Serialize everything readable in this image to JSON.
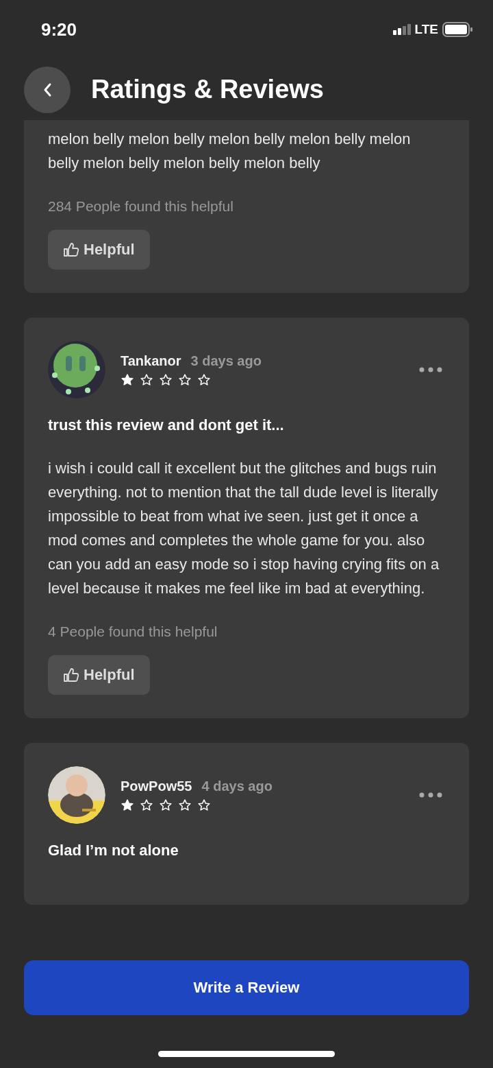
{
  "status_bar": {
    "time": "9:20",
    "network": "LTE"
  },
  "header": {
    "title": "Ratings & Reviews"
  },
  "reviews": [
    {
      "body": "melon belly melon belly melon belly melon belly melon belly melon belly melon belly melon belly",
      "helpful_count": "284 People found this helpful",
      "helpful_button": "Helpful"
    },
    {
      "author": "Tankanor",
      "time": "3 days ago",
      "stars": 1,
      "title": "trust this review and dont get it...",
      "body": "i wish i could call it excellent but the glitches and bugs ruin everything. not to mention that the tall dude level is literally impossible to beat from what ive seen. just get it once a mod comes and completes the whole game for you. also can you add an easy mode so i stop having crying fits on a level because it makes me feel like im bad at everything.",
      "helpful_count": "4 People found this helpful",
      "helpful_button": "Helpful"
    },
    {
      "author": "PowPow55",
      "time": "4 days ago",
      "stars": 1,
      "title": "Glad I’m not alone"
    }
  ],
  "write_button": "Write a Review"
}
